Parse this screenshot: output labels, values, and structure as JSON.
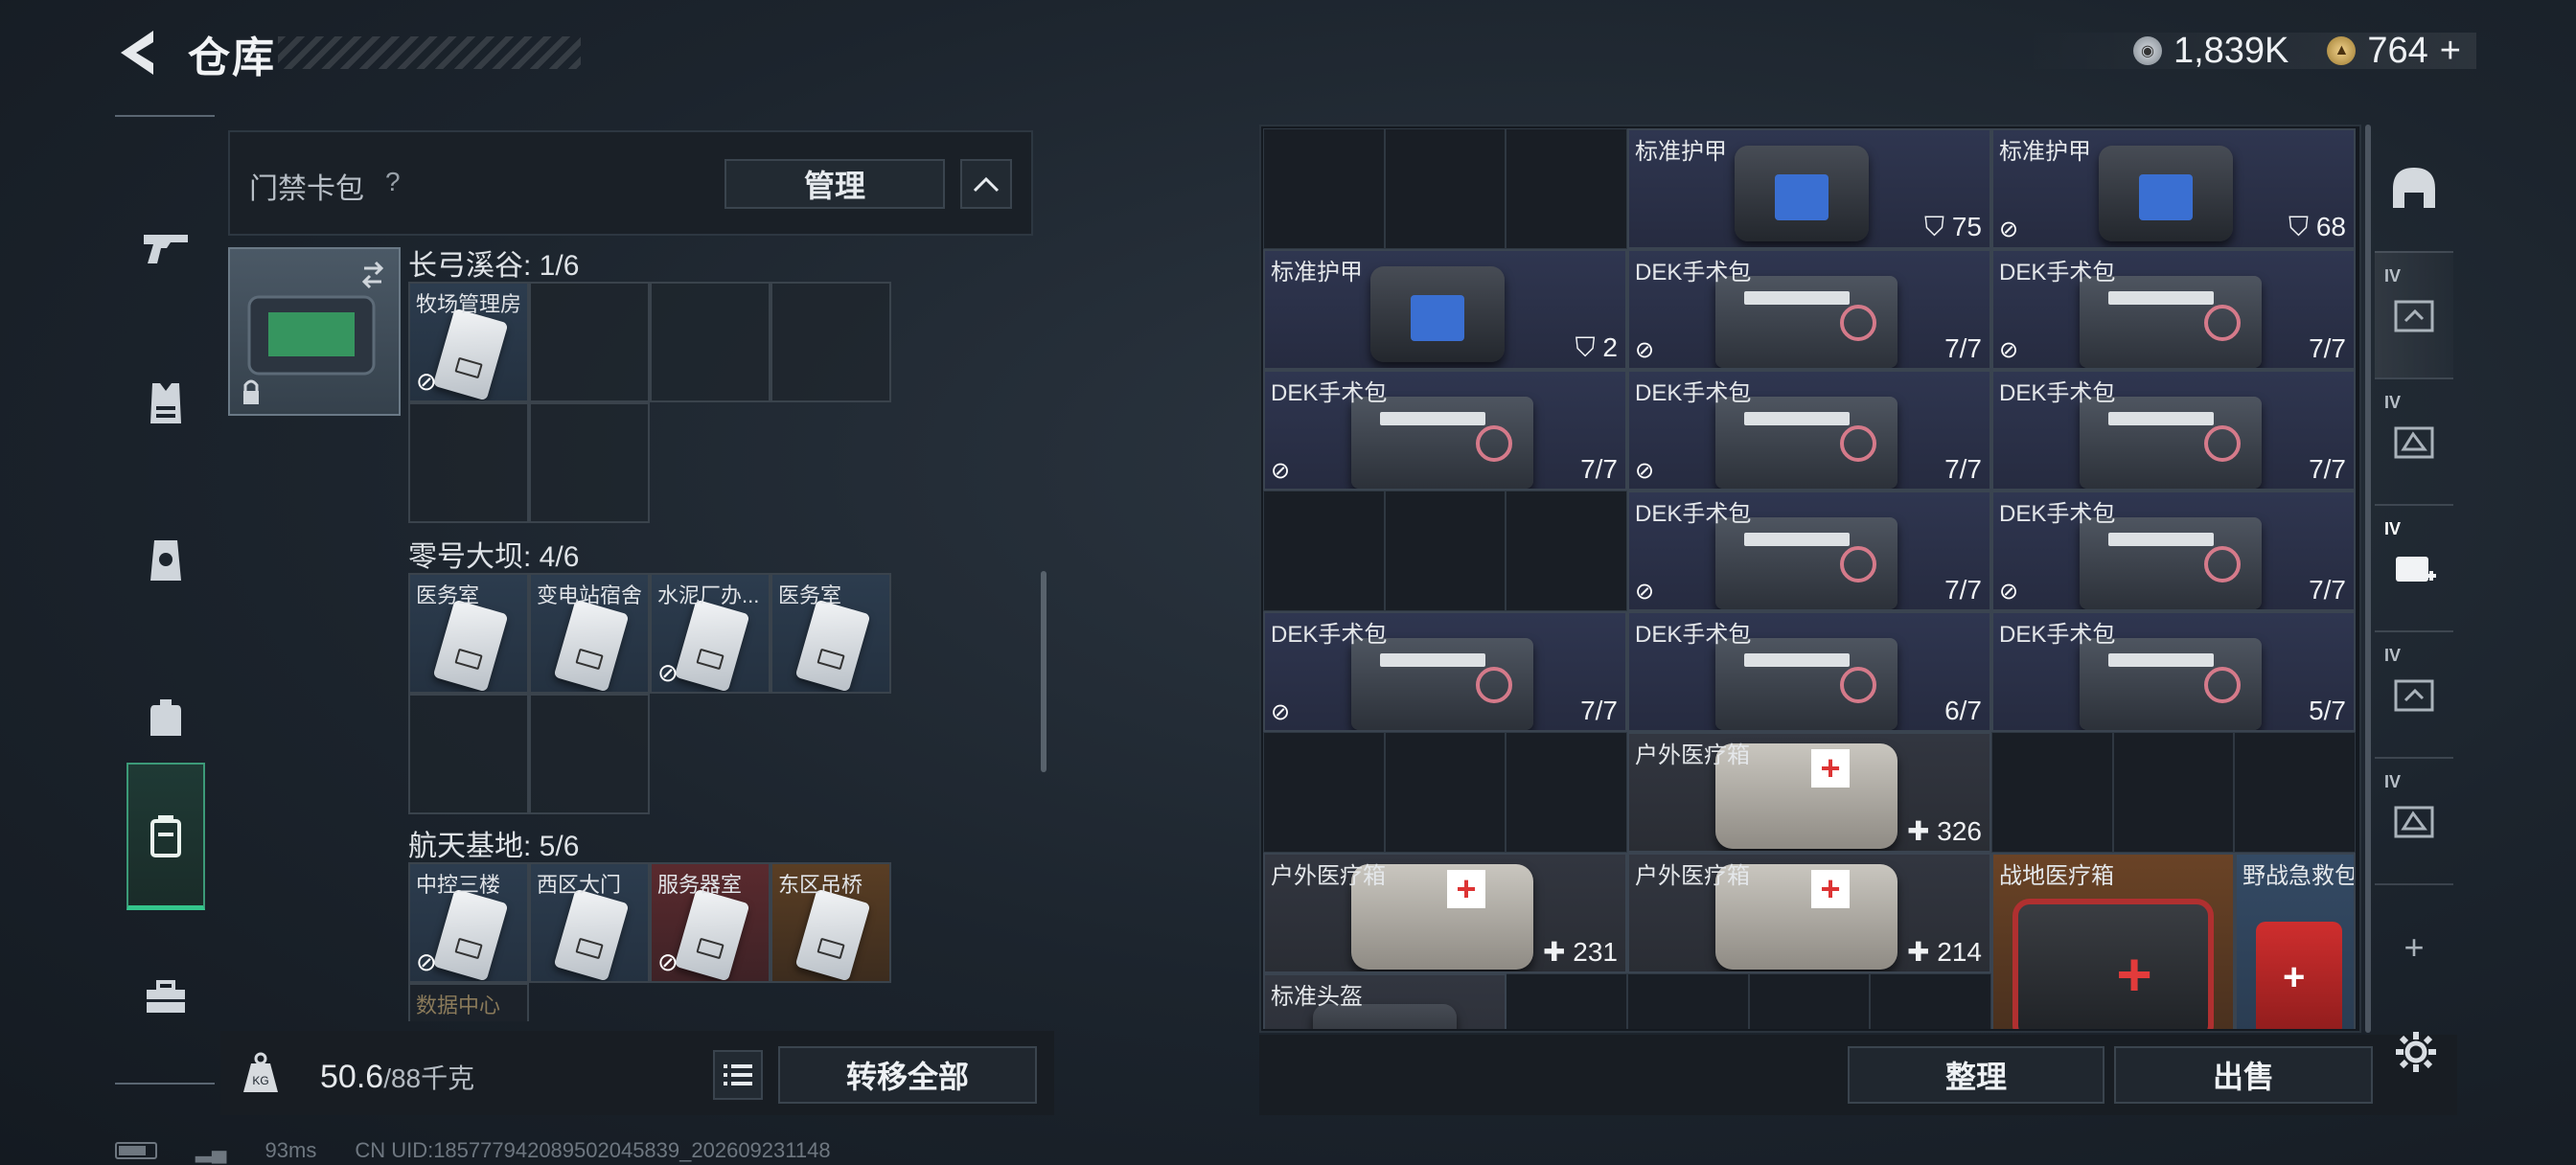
{
  "header": {
    "title": "仓库",
    "currency": [
      {
        "icon": "silver-coin-icon",
        "value": "1,839K"
      },
      {
        "icon": "gold-coin-icon",
        "value": "764"
      }
    ],
    "add_label": "+"
  },
  "left_nav": [
    "gun-icon",
    "armor-vest-icon",
    "chest-rig-icon",
    "backpack-icon",
    "keycard-case-icon",
    "toolbox-icon"
  ],
  "card_panel": {
    "title": "门禁卡包",
    "help": "?",
    "manage_label": "管理",
    "sections": [
      {
        "title": "长弓溪谷: 1/6",
        "cards": [
          {
            "label": "牧场管理房",
            "color": "blue",
            "nosell": true
          }
        ]
      },
      {
        "title": "零号大坝: 4/6",
        "cards": [
          {
            "label": "医务室",
            "color": "blue",
            "nosell": false
          },
          {
            "label": "变电站宿舍",
            "color": "blue",
            "nosell": false
          },
          {
            "label": "水泥厂办...",
            "color": "blue",
            "nosell": true
          },
          {
            "label": "医务室",
            "color": "blue",
            "nosell": false
          }
        ]
      },
      {
        "title": "航天基地: 5/6",
        "cards": [
          {
            "label": "中控三楼",
            "color": "blue",
            "nosell": true
          },
          {
            "label": "西区大门",
            "color": "blue",
            "nosell": false
          },
          {
            "label": "服务器室",
            "color": "red",
            "nosell": true
          },
          {
            "label": "东区吊桥",
            "color": "orange",
            "nosell": false
          }
        ],
        "extra": "数据中心"
      }
    ]
  },
  "weight": {
    "value": "50.6",
    "max": "/88千克",
    "unit_icon": "KG"
  },
  "transfer_all_label": "转移全部",
  "stash": {
    "items": [
      {
        "label": "标准护甲",
        "type": "armor",
        "value": "75",
        "value_icon": "shield",
        "nosell": false
      },
      {
        "label": "标准护甲",
        "type": "armor",
        "value": "68",
        "value_icon": "shield",
        "nosell": true
      },
      {
        "label": "标准护甲",
        "type": "armor",
        "value": "2",
        "value_icon": "shield",
        "nosell": false
      },
      {
        "label": "DEK手术包",
        "type": "kit",
        "value": "7/7",
        "nosell": true
      },
      {
        "label": "DEK手术包",
        "type": "kit",
        "value": "7/7",
        "nosell": true
      },
      {
        "label": "DEK手术包",
        "type": "kit",
        "value": "7/7",
        "nosell": true
      },
      {
        "label": "DEK手术包",
        "type": "kit",
        "value": "7/7",
        "nosell": true
      },
      {
        "label": "DEK手术包",
        "type": "kit",
        "value": "7/7",
        "nosell": true
      },
      {
        "label": "DEK手术包",
        "type": "kit",
        "value": "7/7",
        "nosell": true
      },
      {
        "label": "DEK手术包",
        "type": "kit",
        "value": "7/7",
        "nosell": true
      },
      {
        "label": "DEK手术包",
        "type": "kit",
        "value": "7/7",
        "nosell": true
      },
      {
        "label": "DEK手术包",
        "type": "kit",
        "value": "6/7",
        "nosell": false
      },
      {
        "label": "DEK手术包",
        "type": "kit",
        "value": "5/7",
        "nosell": false
      },
      {
        "label": "户外医疗箱",
        "type": "outdoor",
        "value": "326",
        "value_icon": "plus"
      },
      {
        "label": "户外医疗箱",
        "type": "outdoor",
        "value": "231",
        "value_icon": "plus"
      },
      {
        "label": "户外医疗箱",
        "type": "outdoor",
        "value": "214",
        "value_icon": "plus"
      },
      {
        "label": "战地医疗箱",
        "type": "field"
      },
      {
        "label": "野战急救包",
        "type": "aid"
      },
      {
        "label": "标准头盔",
        "type": "helmet"
      }
    ]
  },
  "right_nav": [
    {
      "icon": "helmet-icon",
      "tag": ""
    },
    {
      "icon": "armor-plate-icon",
      "tag": "IV"
    },
    {
      "icon": "armor-plate-alt-icon",
      "tag": "IV"
    },
    {
      "icon": "medkit-icon",
      "tag": "IV"
    },
    {
      "icon": "armor-plate-icon-2",
      "tag": "IV"
    },
    {
      "icon": "armor-plate-alt-icon-2",
      "tag": "IV"
    },
    {
      "icon": "add-tab-icon",
      "tag": "+"
    }
  ],
  "sort_label": "整理",
  "sell_label": "出售",
  "status": {
    "ping": "93ms",
    "uid": "CN UID:18577794208950204583​9_202609231148"
  }
}
